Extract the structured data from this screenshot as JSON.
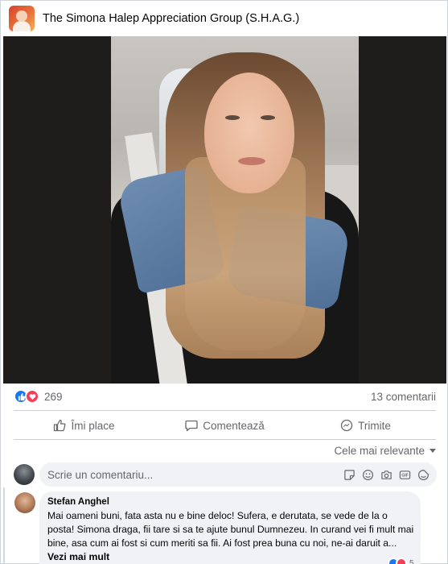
{
  "group": {
    "name": "The Simona Halep Appreciation Group (S.H.A.G.)"
  },
  "reactions": {
    "count": "269",
    "comments_count": "13 comentarii"
  },
  "actions": {
    "like": "Îmi place",
    "comment": "Comentează",
    "share": "Trimite"
  },
  "sort": {
    "label": "Cele mai relevante"
  },
  "composer": {
    "placeholder": "Scrie un comentariu..."
  },
  "comment": {
    "author": "Stefan Anghel",
    "text": "Mai oameni buni, fata asta nu e bine deloc! Sufera, e derutata, se vede de la o posta! Simona draga, fii tare si sa te ajute bunul Dumnezeu. In curand vei fi mult mai bine, asa cum ai fost si cum meriti sa fii. Ai fost prea buna cu noi, ne-ai daruit a...",
    "see_more": "Vezi mai mult",
    "reaction_count": "5"
  },
  "colors": {
    "accent": "#1877f2",
    "love": "#f33e58",
    "muted_text": "#65676b",
    "input_bg": "#f0f2f5"
  }
}
